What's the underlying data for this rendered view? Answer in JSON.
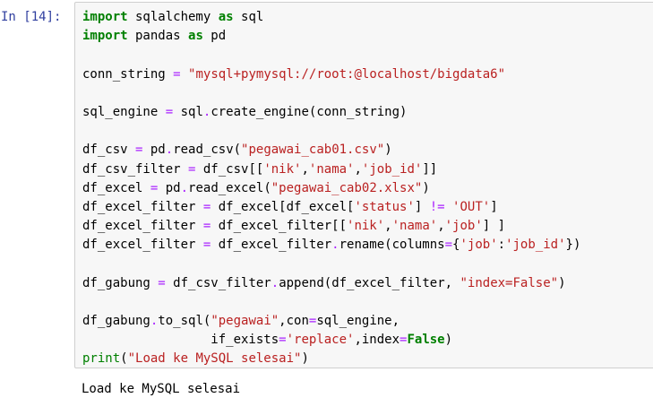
{
  "cell": {
    "prompt": "In [14]:",
    "lines": [
      [
        {
          "t": "kw",
          "v": "import"
        },
        {
          "t": "",
          "v": " sqlalchemy "
        },
        {
          "t": "kw",
          "v": "as"
        },
        {
          "t": "",
          "v": " sql"
        }
      ],
      [
        {
          "t": "kw",
          "v": "import"
        },
        {
          "t": "",
          "v": " pandas "
        },
        {
          "t": "kw",
          "v": "as"
        },
        {
          "t": "",
          "v": " pd"
        }
      ],
      [],
      [
        {
          "t": "",
          "v": "conn_string "
        },
        {
          "t": "op",
          "v": "="
        },
        {
          "t": "",
          "v": " "
        },
        {
          "t": "st",
          "v": "\"mysql+pymysql://root:@localhost/bigdata6\""
        }
      ],
      [],
      [
        {
          "t": "",
          "v": "sql_engine "
        },
        {
          "t": "op",
          "v": "="
        },
        {
          "t": "",
          "v": " sql"
        },
        {
          "t": "op",
          "v": "."
        },
        {
          "t": "",
          "v": "create_engine(conn_string)"
        }
      ],
      [],
      [
        {
          "t": "",
          "v": "df_csv "
        },
        {
          "t": "op",
          "v": "="
        },
        {
          "t": "",
          "v": " pd"
        },
        {
          "t": "op",
          "v": "."
        },
        {
          "t": "",
          "v": "read_csv("
        },
        {
          "t": "st",
          "v": "\"pegawai_cab01.csv\""
        },
        {
          "t": "",
          "v": ")"
        }
      ],
      [
        {
          "t": "",
          "v": "df_csv_filter "
        },
        {
          "t": "op",
          "v": "="
        },
        {
          "t": "",
          "v": " df_csv[["
        },
        {
          "t": "st",
          "v": "'nik'"
        },
        {
          "t": "",
          "v": ","
        },
        {
          "t": "st",
          "v": "'nama'"
        },
        {
          "t": "",
          "v": ","
        },
        {
          "t": "st",
          "v": "'job_id'"
        },
        {
          "t": "",
          "v": "]]"
        }
      ],
      [
        {
          "t": "",
          "v": "df_excel "
        },
        {
          "t": "op",
          "v": "="
        },
        {
          "t": "",
          "v": " pd"
        },
        {
          "t": "op",
          "v": "."
        },
        {
          "t": "",
          "v": "read_excel("
        },
        {
          "t": "st",
          "v": "\"pegawai_cab02.xlsx\""
        },
        {
          "t": "",
          "v": ")"
        }
      ],
      [
        {
          "t": "",
          "v": "df_excel_filter "
        },
        {
          "t": "op",
          "v": "="
        },
        {
          "t": "",
          "v": " df_excel[df_excel["
        },
        {
          "t": "st",
          "v": "'status'"
        },
        {
          "t": "",
          "v": "] "
        },
        {
          "t": "op",
          "v": "!="
        },
        {
          "t": "",
          "v": " "
        },
        {
          "t": "st",
          "v": "'OUT'"
        },
        {
          "t": "",
          "v": "]"
        }
      ],
      [
        {
          "t": "",
          "v": "df_excel_filter "
        },
        {
          "t": "op",
          "v": "="
        },
        {
          "t": "",
          "v": " df_excel_filter[["
        },
        {
          "t": "st",
          "v": "'nik'"
        },
        {
          "t": "",
          "v": ","
        },
        {
          "t": "st",
          "v": "'nama'"
        },
        {
          "t": "",
          "v": ","
        },
        {
          "t": "st",
          "v": "'job'"
        },
        {
          "t": "",
          "v": "] ]"
        }
      ],
      [
        {
          "t": "",
          "v": "df_excel_filter "
        },
        {
          "t": "op",
          "v": "="
        },
        {
          "t": "",
          "v": " df_excel_filter"
        },
        {
          "t": "op",
          "v": "."
        },
        {
          "t": "",
          "v": "rename(columns"
        },
        {
          "t": "op",
          "v": "="
        },
        {
          "t": "",
          "v": "{"
        },
        {
          "t": "st",
          "v": "'job'"
        },
        {
          "t": "",
          "v": ":"
        },
        {
          "t": "st",
          "v": "'job_id'"
        },
        {
          "t": "",
          "v": "})"
        }
      ],
      [],
      [
        {
          "t": "",
          "v": "df_gabung "
        },
        {
          "t": "op",
          "v": "="
        },
        {
          "t": "",
          "v": " df_csv_filter"
        },
        {
          "t": "op",
          "v": "."
        },
        {
          "t": "",
          "v": "append(df_excel_filter, "
        },
        {
          "t": "st",
          "v": "\"index=False\""
        },
        {
          "t": "",
          "v": ")"
        }
      ],
      [],
      [
        {
          "t": "",
          "v": "df_gabung"
        },
        {
          "t": "op",
          "v": "."
        },
        {
          "t": "",
          "v": "to_sql("
        },
        {
          "t": "st",
          "v": "\"pegawai\""
        },
        {
          "t": "",
          "v": ",con"
        },
        {
          "t": "op",
          "v": "="
        },
        {
          "t": "",
          "v": "sql_engine,"
        }
      ],
      [
        {
          "t": "",
          "v": "                 if_exists"
        },
        {
          "t": "op",
          "v": "="
        },
        {
          "t": "st",
          "v": "'replace'"
        },
        {
          "t": "",
          "v": ",index"
        },
        {
          "t": "op",
          "v": "="
        },
        {
          "t": "kw",
          "v": "False"
        },
        {
          "t": "",
          "v": ")"
        }
      ],
      [
        {
          "t": "bn",
          "v": "print"
        },
        {
          "t": "",
          "v": "("
        },
        {
          "t": "st",
          "v": "\"Load ke MySQL selesai\""
        },
        {
          "t": "",
          "v": ")"
        }
      ]
    ]
  },
  "output": {
    "text": "Load ke MySQL selesai"
  }
}
